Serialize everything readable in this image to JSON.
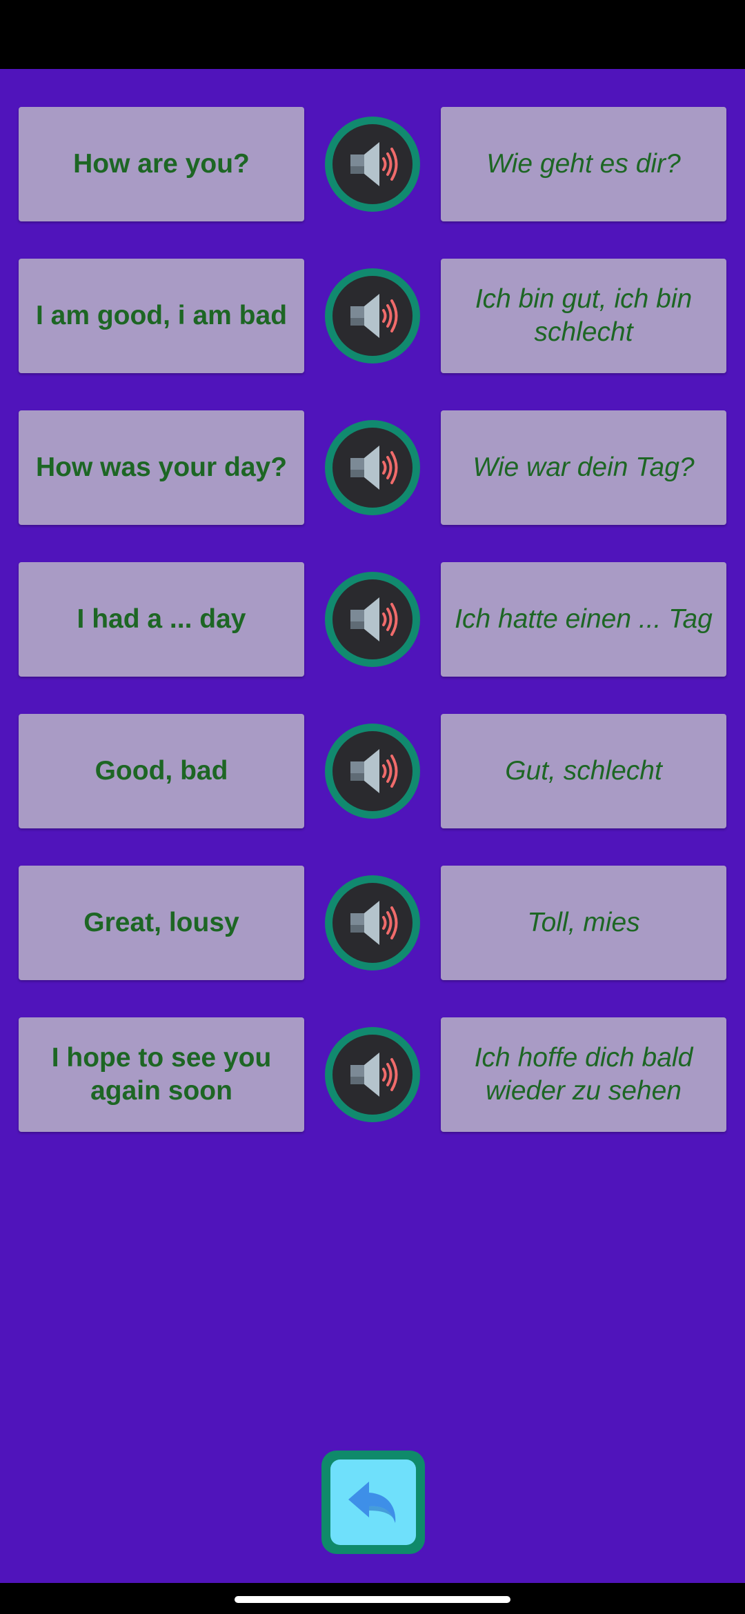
{
  "phrases": [
    {
      "english": "How are you?",
      "german": "Wie geht es dir?"
    },
    {
      "english": "I am good, i am bad",
      "german": "Ich bin gut, ich bin schlecht"
    },
    {
      "english": "How was your day?",
      "german": "Wie war dein Tag?"
    },
    {
      "english": "I had a ... day",
      "german": "Ich hatte einen ... Tag"
    },
    {
      "english": "Good, bad",
      "german": "Gut, schlecht"
    },
    {
      "english": "Great, lousy",
      "german": "Toll, mies"
    },
    {
      "english": "I hope to see you again soon",
      "german": "Ich hoffe dich bald wieder zu sehen"
    }
  ],
  "icons": {
    "speaker": "speaker-icon",
    "back": "back-arrow-icon"
  },
  "colors": {
    "background": "#5014bb",
    "card": "#a99bc5",
    "text": "#1d6624",
    "speaker_ring": "#118a6f",
    "back_button": "#6fe0fb"
  }
}
